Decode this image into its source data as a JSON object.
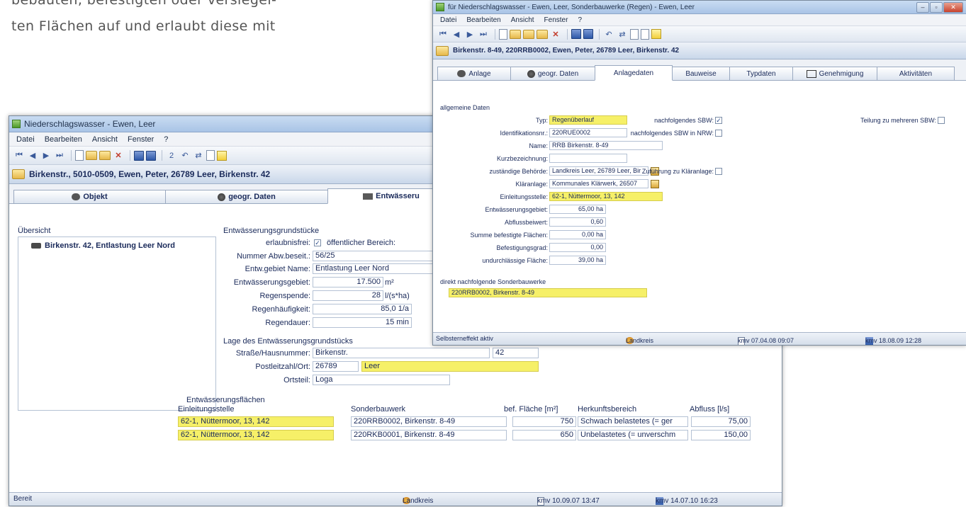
{
  "doc": {
    "line1": "bebauten, befestigten oder versiegel-",
    "line2": "ten Flächen auf und erlaubt diese mit"
  },
  "left_window": {
    "title": "Niederschlagswasser - Ewen, Leer",
    "menu": [
      "Datei",
      "Bearbeiten",
      "Ansicht",
      "Fenster",
      "?"
    ],
    "record": "Birkenstr., 5010-0509, Ewen, Peter, 26789 Leer, Birkenstr. 42",
    "tabs": [
      "Objekt",
      "geogr. Daten",
      "Entwässeru"
    ],
    "overview_label": "Übersicht",
    "tree_item": "Birkenstr. 42, Entlastung Leer Nord",
    "section_grundstuecke": "Entwässerungsgrundstücke",
    "erlaubnisfrei_label": "erlaubnisfrei:",
    "erlaubnisfrei_checked": "✓",
    "oeffentlich_label": "öffentlicher Bereich:",
    "nummer_label": "Nummer Abw.beseit.:",
    "nummer_value": "56/25",
    "gebiet_name_label": "Entw.gebiet Name:",
    "gebiet_name_value": "Entlastung Leer Nord",
    "gebiet_label": "Entwässerungsgebiet:",
    "gebiet_value": "17.500",
    "gebiet_unit": "m²",
    "regenspende_label": "Regenspende:",
    "regenspende_value": "28",
    "regenspende_unit": "l/(s*ha)",
    "haeufigkeit_label": "Regenhäufigkeit:",
    "haeufigkeit_value": "85,0 1/a",
    "dauer_label": "Regendauer:",
    "dauer_value": "15 min",
    "section_lage": "Lage des Entwässerungsgrundstücks",
    "strasse_label": "Straße/Hausnummer:",
    "strasse_value": "Birkenstr.",
    "hausnummer_value": "42",
    "plz_label": "Postleitzahl/Ort:",
    "plz_value": "26789",
    "ort_value": "Leer",
    "ortsteil_label": "Ortsteil:",
    "ortsteil_value": "Loga",
    "section_flaechen": "Entwässerungsflächen",
    "table_headers": [
      "Einleitungsstelle",
      "Sonderbauwerk",
      "bef. Fläche [m²]",
      "Herkunftsbereich",
      "Abfluss [l/s]"
    ],
    "table_rows": [
      [
        "62-1, Nüttermoor, 13, 142",
        "220RRB0002, Birkenstr. 8-49",
        "750",
        "Schwach belastetes (= ger",
        "75,00"
      ],
      [
        "62-1, Nüttermoor, 13, 142",
        "220RKB0001, Birkenstr. 8-49",
        "650",
        "Unbelastetes (= unverschm",
        "150,00"
      ]
    ],
    "status": [
      "Bereit",
      "Landkreis",
      "kmv 10.09.07 13:47",
      "kmv 14.07.10 16:23"
    ]
  },
  "right_window": {
    "title": "für Niederschlagswasser - Ewen, Leer, Sonderbauwerke (Regen) - Ewen, Leer",
    "menu": [
      "Datei",
      "Bearbeiten",
      "Ansicht",
      "Fenster",
      "?"
    ],
    "record": "Birkenstr. 8-49, 220RRB0002, Ewen, Peter, 26789 Leer, Birkenstr. 42",
    "tabs": [
      "Anlage",
      "geogr. Daten",
      "Anlagedaten",
      "Bauweise",
      "Typdaten",
      "Genehmigung",
      "Aktivitäten"
    ],
    "section_allgemein": "allgemeine Daten",
    "typ_label": "Typ:",
    "typ_value": "Regenüberlauf",
    "ident_label": "Identifikationsnr.:",
    "ident_value": "220RUE0002",
    "name_label": "Name:",
    "name_value": "RRB Birkenstr. 8-49",
    "kurz_label": "Kurzbezeichnung:",
    "kurz_value": "",
    "behoerde_label": "zuständige Behörde:",
    "behoerde_value": "Landkreis Leer, 26789 Leer, Bir",
    "klaeranlage_label": "Kläranlage:",
    "klaeranlage_value": "Kommunales Klärwerk, 26507",
    "einleitung_label": "Einleitungsstelle:",
    "einleitung_value": "62-1, Nüttermoor, 13, 142",
    "gebiet_label": "Entwässerungsgebiet:",
    "gebiet_value": "65,00 ha",
    "abfluss_label": "Abflussbeiwert:",
    "abfluss_value": "0,60",
    "summe_label": "Summe befestigte Flächen:",
    "summe_value": "0,00 ha",
    "grad_label": "Befestigungsgrad:",
    "grad_value": "0,00",
    "undurch_label": "undurchlässige Fläche:",
    "undurch_value": "39,00 ha",
    "nachf_label": "nachfolgendes SBW:",
    "nachf_checked": "✓",
    "nrw_label": "nachfolgendes SBW in NRW:",
    "teilung_label": "Teilung zu mehreren SBW:",
    "zufuehrung_label": "Zuführung zu Kläranlage:",
    "direkt_label": "direkt nachfolgende Sonderbauwerke",
    "direkt_value": "220RRB0002, Birkenstr. 8-49",
    "status": [
      "Selbsterneffekt aktiv",
      "Landkreis",
      "kmv 07.04.08 09:07",
      "kmv 18.08.09 12:28"
    ]
  }
}
